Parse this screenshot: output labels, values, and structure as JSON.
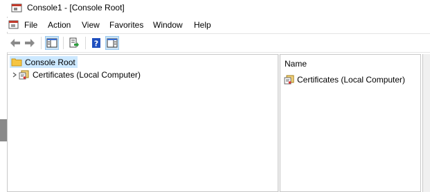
{
  "window": {
    "title": "Console1 - [Console Root]"
  },
  "menu": [
    "File",
    "Action",
    "View",
    "Favorites",
    "Window",
    "Help"
  ],
  "toolbar": {
    "buttons": [
      "back-arrow-icon",
      "forward-arrow-icon",
      "show-hide-console-tree-icon",
      "export-list-icon",
      "help-icon",
      "show-hide-action-pane-icon"
    ]
  },
  "tree": {
    "root_label": "Console Root",
    "child_label": "Certificates (Local Computer)"
  },
  "list": {
    "column_header": "Name",
    "items": [
      "Certificates (Local Computer)"
    ]
  },
  "colors": {
    "selection": "#cce8ff",
    "pressed_button": "#cce4f7",
    "folder": "#f5c542",
    "help_blue": "#1f4fbf"
  }
}
